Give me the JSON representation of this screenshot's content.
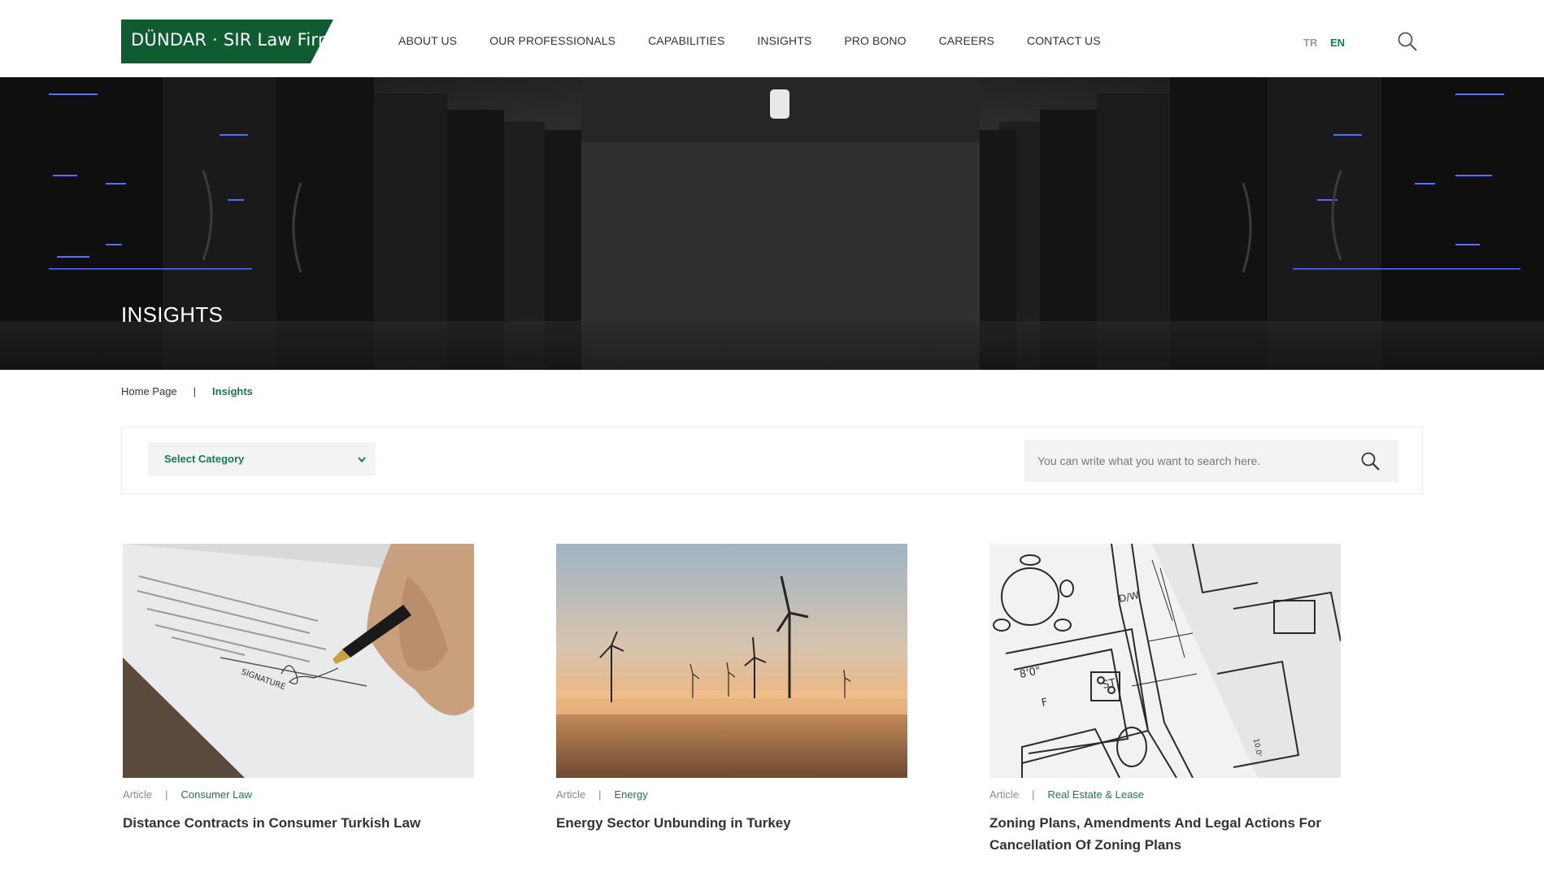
{
  "brand": {
    "logo_text": "DÜNDAR · SIR  Law Firm",
    "color": "#0f5c33"
  },
  "nav": {
    "items": [
      "ABOUT US",
      "OUR PROFESSIONALS",
      "CAPABILITIES",
      "INSIGHTS",
      "PRO BONO",
      "CAREERS",
      "CONTACT US"
    ]
  },
  "lang": {
    "tr": "TR",
    "en": "EN",
    "active": "EN"
  },
  "hero": {
    "title": "INSIGHTS"
  },
  "breadcrumb": {
    "home": "Home Page",
    "separator": "|",
    "current": "Insights"
  },
  "filter": {
    "category_label": "Select Category",
    "search_placeholder": "You can write what you want to search here."
  },
  "cards": [
    {
      "type": "Article",
      "category": "Consumer Law",
      "title": "Distance Contracts in Consumer Turkish Law",
      "image": "signature-image"
    },
    {
      "type": "Article",
      "category": "Energy",
      "title": "Energy Sector Unbunding in Turkey",
      "image": "wind-turbines-image"
    },
    {
      "type": "Article",
      "category": "Real Estate & Lease",
      "title": "Zoning Plans, Amendments And Legal Actions For Cancellation Of Zoning Plans",
      "image": "floor-plan-image"
    }
  ],
  "colors": {
    "accent": "#1a7a4a",
    "text": "#333333",
    "muted": "#8a8a8a",
    "panel": "#f3f3f3"
  }
}
